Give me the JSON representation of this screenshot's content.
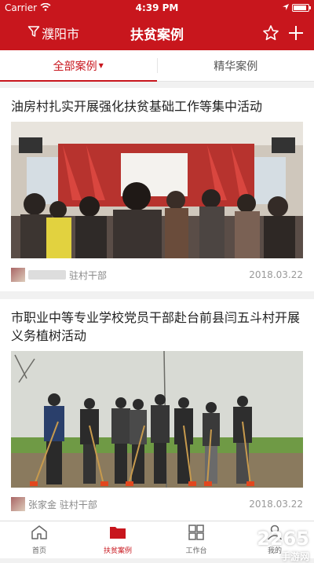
{
  "status": {
    "carrier": "Carrier",
    "time": "4:39 PM"
  },
  "nav": {
    "city": "濮阳市",
    "title": "扶贫案例"
  },
  "tabs": [
    {
      "label": "全部案例"
    },
    {
      "label": "精华案例"
    }
  ],
  "cards": [
    {
      "title": "油房村扎实开展强化扶贫基础工作等集中活动",
      "author": "驻村干部",
      "date": "2018.03.22"
    },
    {
      "title": "市职业中等专业学校党员干部赴台前县闫五斗村开展义务植树活动",
      "author": "张家金 驻村干部",
      "date": "2018.03.22"
    }
  ],
  "tabbar": [
    {
      "label": "首页"
    },
    {
      "label": "扶贫案例"
    },
    {
      "label": "工作台"
    },
    {
      "label": "我的"
    }
  ],
  "watermark": {
    "main": "2265",
    "sub": "手游网"
  },
  "colors": {
    "brand": "#c8161d"
  }
}
